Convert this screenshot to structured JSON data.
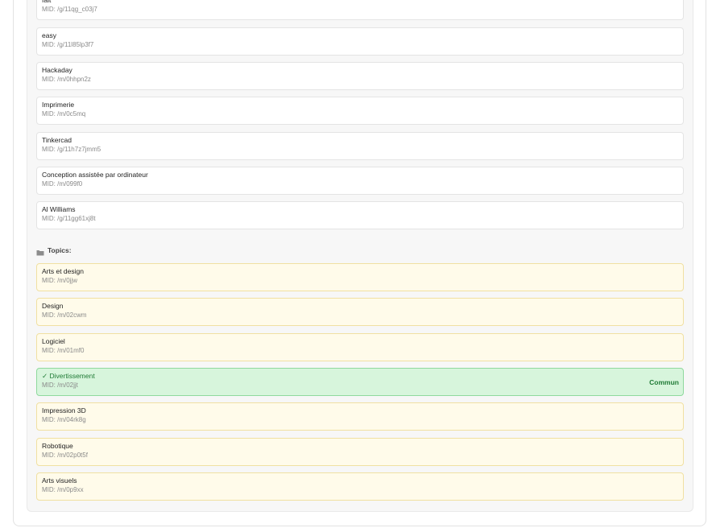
{
  "entities": [
    {
      "name": "fait",
      "mid": "MID: /g/11qg_c03j7"
    },
    {
      "name": "easy",
      "mid": "MID: /g/11l85lp3f7"
    },
    {
      "name": "Hackaday",
      "mid": "MID: /m/0hhpn2z"
    },
    {
      "name": "Imprimerie",
      "mid": "MID: /m/0c5mq"
    },
    {
      "name": "Tinkercad",
      "mid": "MID: /g/11h7z7jmm5"
    },
    {
      "name": "Conception assistée par ordinateur",
      "mid": "MID: /m/099f0"
    },
    {
      "name": "Al Williams",
      "mid": "MID: /g/11gg61xj8t"
    }
  ],
  "topics_section": {
    "icon": "folder-icon",
    "label": "Topics:",
    "items": [
      {
        "name": "Arts et design",
        "mid": "MID: /m/0jjw"
      },
      {
        "name": "Design",
        "mid": "MID: /m/02cwm"
      },
      {
        "name": "Logiciel",
        "mid": "MID: /m/01mf0"
      },
      {
        "name": "✓ Divertissement",
        "mid": "MID: /m/02jjt",
        "badge": "Commun"
      },
      {
        "name": "Impression 3D",
        "mid": "MID: /m/04rk8g"
      },
      {
        "name": "Robotique",
        "mid": "MID: /m/02p0t5f"
      },
      {
        "name": "Arts visuels",
        "mid": "MID: /m/0p9xx"
      }
    ]
  },
  "colors": {
    "topic_bg": "#fffbea",
    "topic_border": "#f0e0a2",
    "common_bg": "#d7f5dc",
    "common_text": "#1f7a35"
  }
}
